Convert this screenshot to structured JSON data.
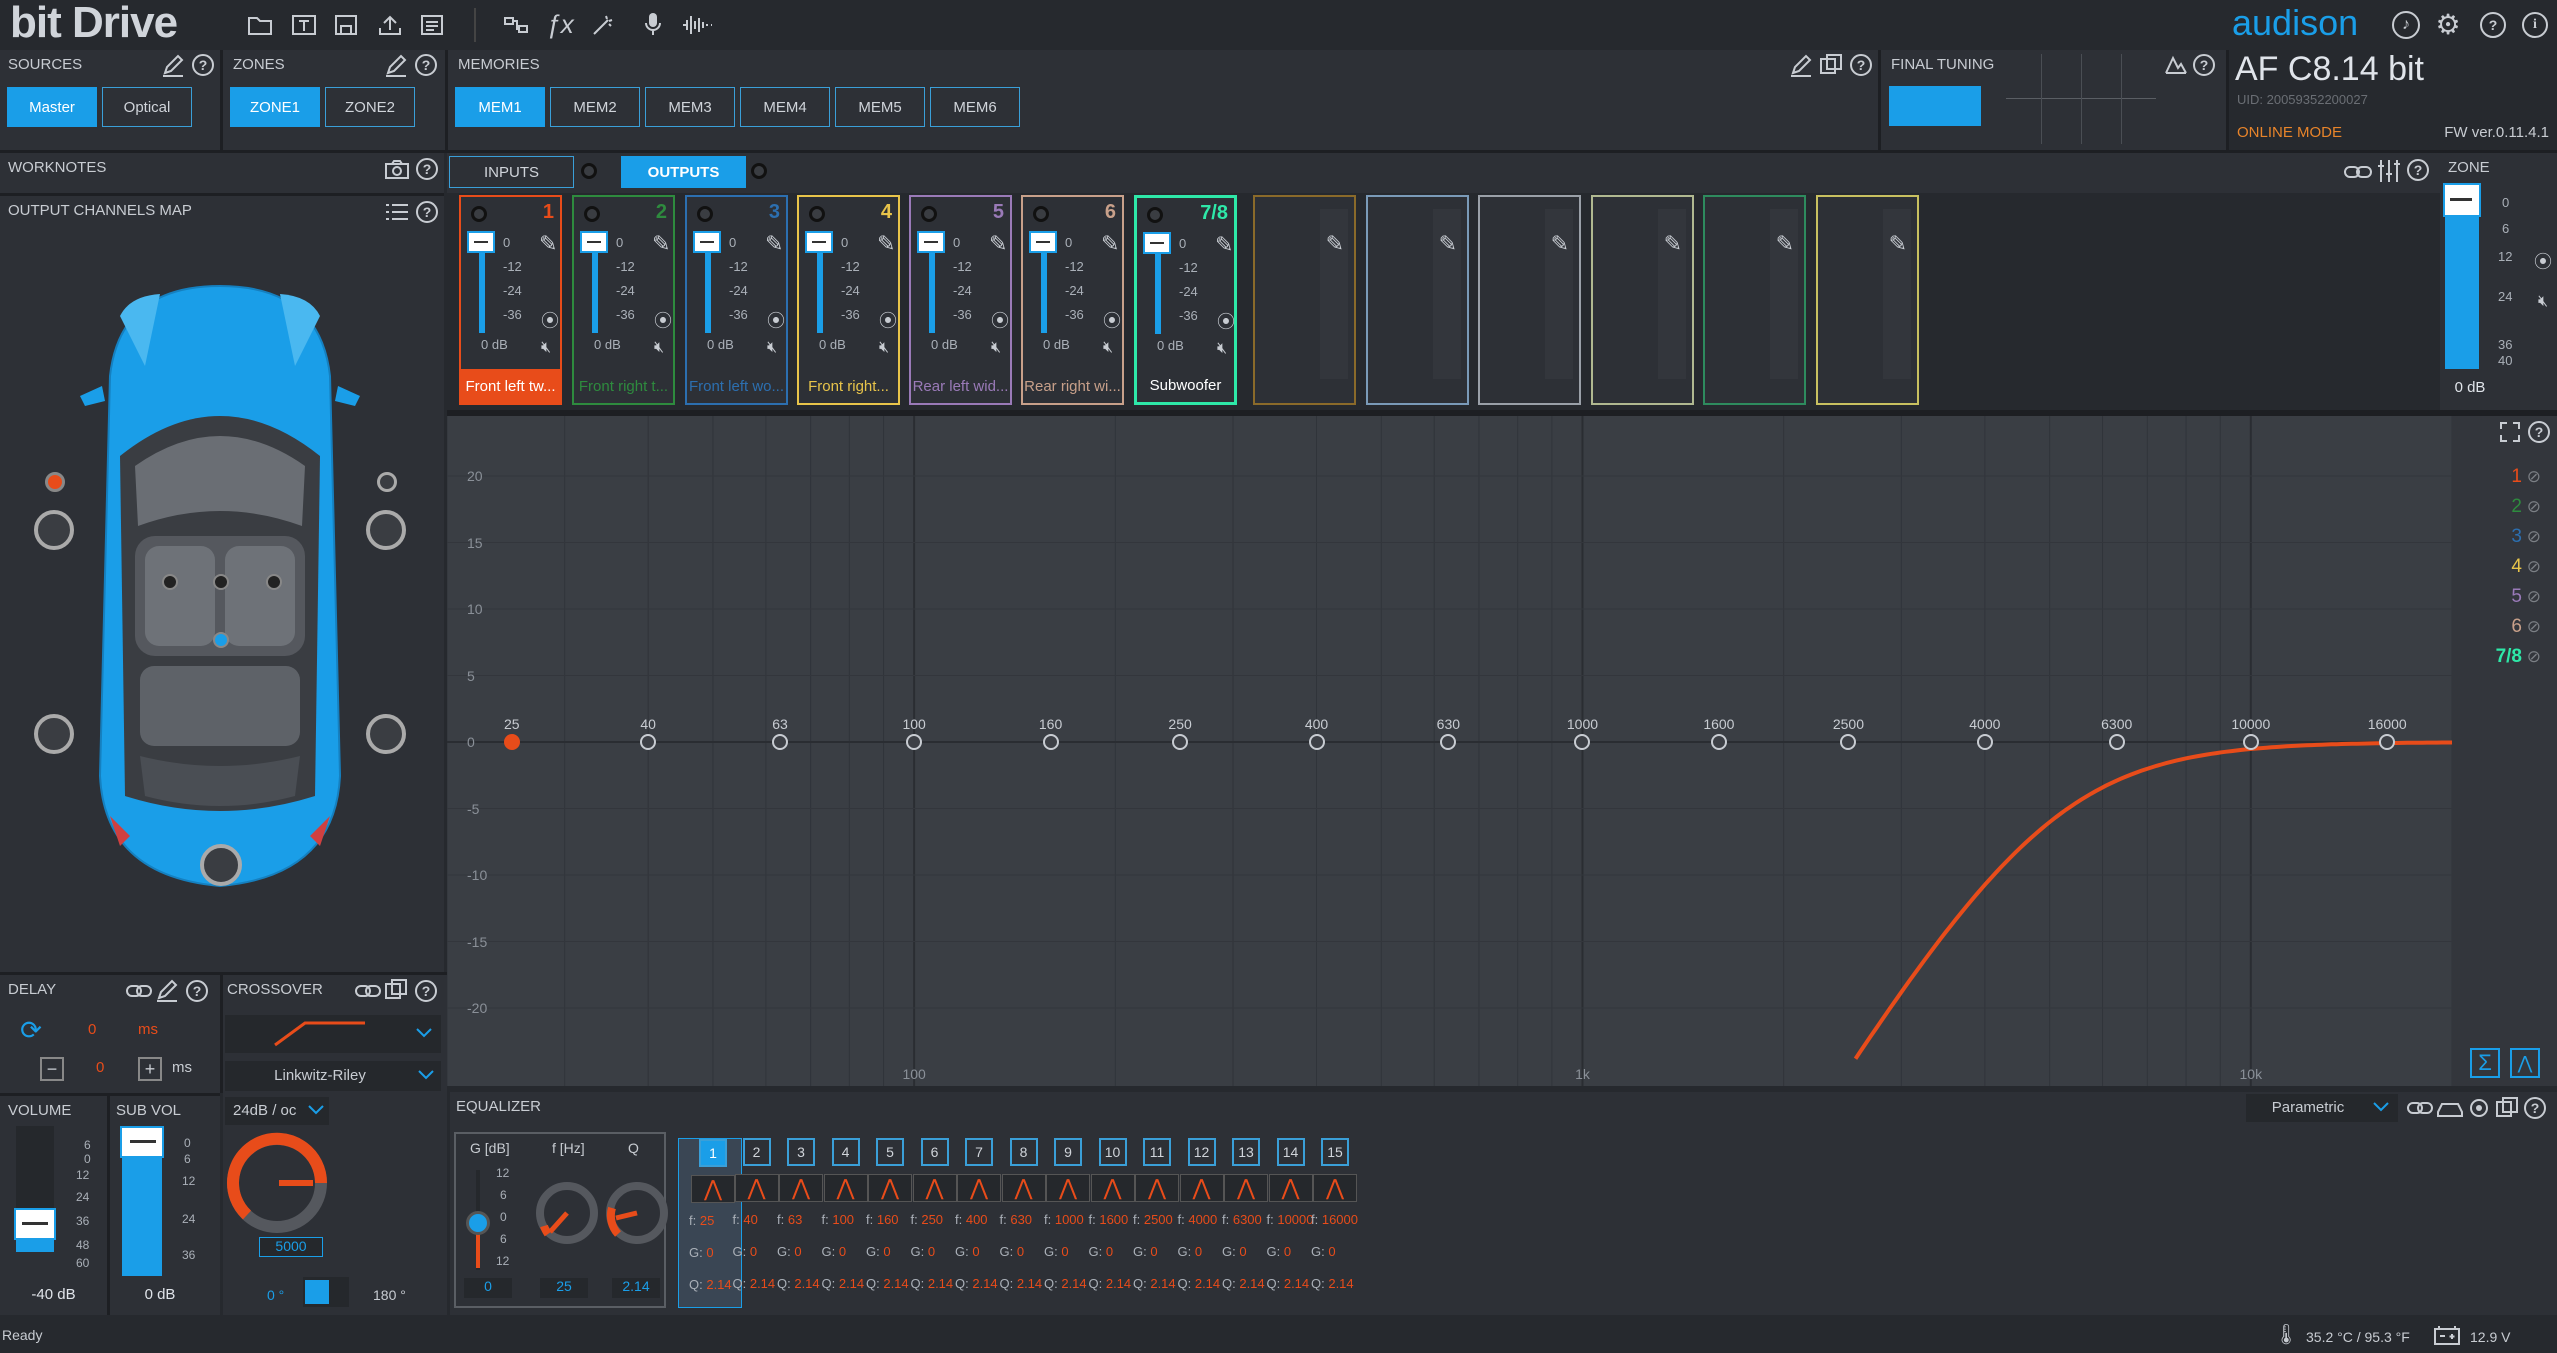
{
  "app": {
    "title": "bit Drive",
    "brand": "audison",
    "device": "AF C8.14 bit",
    "uid": "UID: 20059352200027",
    "mode": "ONLINE MODE",
    "fw": "FW ver.0.11.4.1"
  },
  "sources": {
    "label": "SOURCES",
    "buttons": [
      "Master",
      "Optical"
    ]
  },
  "zones": {
    "label": "ZONES",
    "buttons": [
      "ZONE1",
      "ZONE2"
    ]
  },
  "memories": {
    "label": "MEMORIES",
    "buttons": [
      "MEM1",
      "MEM2",
      "MEM3",
      "MEM4",
      "MEM5",
      "MEM6"
    ]
  },
  "final_tuning": {
    "label": "FINAL TUNING"
  },
  "worknotes": {
    "label": "WORKNOTES"
  },
  "io_tabs": {
    "inputs": "INPUTS",
    "outputs": "OUTPUTS"
  },
  "map": {
    "label": "OUTPUT CHANNELS MAP"
  },
  "zone_panel": {
    "label": "ZONE",
    "scale": [
      "0",
      "6",
      "12",
      "24",
      "36",
      "40"
    ],
    "value": "0 dB"
  },
  "channel_scale": [
    "0",
    "-12",
    "-24",
    "-36"
  ],
  "channels": [
    {
      "num": "1",
      "name": "Front left tw...",
      "db": "0 dB",
      "color": "#e84c1a",
      "active": false,
      "filled": true
    },
    {
      "num": "2",
      "name": "Front right t...",
      "db": "0 dB",
      "color": "#2e8b3e",
      "active": false,
      "filled": false
    },
    {
      "num": "3",
      "name": "Front left wo...",
      "db": "0 dB",
      "color": "#2c6fb0",
      "active": false,
      "filled": false
    },
    {
      "num": "4",
      "name": "Front right...",
      "db": "0 dB",
      "color": "#e8c44a",
      "active": false,
      "filled": false
    },
    {
      "num": "5",
      "name": "Rear left wid...",
      "db": "0 dB",
      "color": "#9a7ab8",
      "active": false,
      "filled": false
    },
    {
      "num": "6",
      "name": "Rear right wi...",
      "db": "0 dB",
      "color": "#c8a08a",
      "active": false,
      "filled": false
    },
    {
      "num": "7/8",
      "name": "Subwoofer",
      "db": "0 dB",
      "color": "#2ee8a8",
      "active": true,
      "filled": false
    }
  ],
  "empty_slots": [
    "#8a6a2a",
    "#7a9ab8",
    "#9aa0a8",
    "#b0b890",
    "#2e8b5e",
    "#c8c060"
  ],
  "graph": {
    "y_ticks": [
      "20",
      "15",
      "10",
      "5",
      "0",
      "-5",
      "-10",
      "-15",
      "-20"
    ],
    "freq_labels": [
      "25",
      "40",
      "63",
      "100",
      "160",
      "250",
      "400",
      "630",
      "1000",
      "1600",
      "2500",
      "4000",
      "6300",
      "10000",
      "16000"
    ],
    "decade_labels": [
      "100",
      "1k",
      "10k"
    ],
    "legend": [
      {
        "label": "1",
        "color": "#e84c1a"
      },
      {
        "label": "2",
        "color": "#2e8b3e"
      },
      {
        "label": "3",
        "color": "#2c6fb0"
      },
      {
        "label": "4",
        "color": "#e8c44a"
      },
      {
        "label": "5",
        "color": "#9a7ab8"
      },
      {
        "label": "6",
        "color": "#c8a08a"
      },
      {
        "label": "7/8",
        "color": "#2ee8a8"
      }
    ]
  },
  "delay": {
    "label": "DELAY",
    "value_ms": "0",
    "unit_ms": "ms",
    "step_value": "0",
    "step_unit": "ms"
  },
  "crossover": {
    "label": "CROSSOVER",
    "type": "Linkwitz-Riley",
    "slope": "24dB / oc",
    "freq": "5000",
    "phase_0": "0 °",
    "phase_180": "180 °"
  },
  "volume": {
    "label": "VOLUME",
    "scale": [
      "6",
      "0",
      "12",
      "24",
      "36",
      "48",
      "60"
    ],
    "value": "-40 dB"
  },
  "subvol": {
    "label": "SUB VOL",
    "scale": [
      "0",
      "6",
      "12",
      "24",
      "36"
    ],
    "value": "0 dB"
  },
  "equalizer": {
    "label": "EQUALIZER",
    "mode": "Parametric",
    "heads": {
      "g": "G [dB]",
      "f": "f [Hz]",
      "q": "Q"
    },
    "g_scale": [
      "12",
      "6",
      "0",
      "6",
      "12"
    ],
    "current": {
      "g": "0",
      "f": "25",
      "q": "2.14"
    },
    "bands": [
      {
        "n": "1",
        "f": "25",
        "g": "0",
        "q": "2.14"
      },
      {
        "n": "2",
        "f": "40",
        "g": "0",
        "q": "2.14"
      },
      {
        "n": "3",
        "f": "63",
        "g": "0",
        "q": "2.14"
      },
      {
        "n": "4",
        "f": "100",
        "g": "0",
        "q": "2.14"
      },
      {
        "n": "5",
        "f": "160",
        "g": "0",
        "q": "2.14"
      },
      {
        "n": "6",
        "f": "250",
        "g": "0",
        "q": "2.14"
      },
      {
        "n": "7",
        "f": "400",
        "g": "0",
        "q": "2.14"
      },
      {
        "n": "8",
        "f": "630",
        "g": "0",
        "q": "2.14"
      },
      {
        "n": "9",
        "f": "1000",
        "g": "0",
        "q": "2.14"
      },
      {
        "n": "10",
        "f": "1600",
        "g": "0",
        "q": "2.14"
      },
      {
        "n": "11",
        "f": "2500",
        "g": "0",
        "q": "2.14"
      },
      {
        "n": "12",
        "f": "4000",
        "g": "0",
        "q": "2.14"
      },
      {
        "n": "13",
        "f": "6300",
        "g": "0",
        "q": "2.14"
      },
      {
        "n": "14",
        "f": "10000",
        "g": "0",
        "q": "2.14"
      },
      {
        "n": "15",
        "f": "16000",
        "g": "0",
        "q": "2.14"
      }
    ]
  },
  "status": {
    "text": "Ready",
    "temp": "35.2 °C / 95.3 °F",
    "voltage": "12.9 V"
  }
}
